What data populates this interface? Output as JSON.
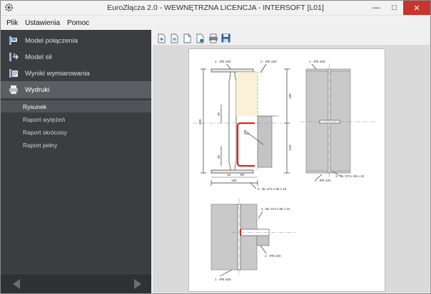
{
  "window": {
    "title": "EuroZłącza 2.0 - WEWNĘTRZNA LICENCJA - INTERSOFT [L01]",
    "app_icon": "gear-app-icon",
    "controls": [
      "minimize-icon",
      "maximize-icon",
      "close-icon"
    ]
  },
  "menu": {
    "items": [
      "Plik",
      "Ustawienia",
      "Pomoc"
    ]
  },
  "sidebar": {
    "items": [
      {
        "label": "Model połączenia",
        "icon": "connection-model-icon"
      },
      {
        "label": "Model sił",
        "icon": "forces-model-icon"
      },
      {
        "label": "Wyniki wymiarowania",
        "icon": "results-icon"
      },
      {
        "label": "Wydruki",
        "icon": "printer-icon"
      }
    ],
    "subitems": [
      "Rysunek",
      "Raport wytężeń",
      "Raport skrócony",
      "Raport pełny"
    ],
    "selected": "Wydruki",
    "active_subitem": "Rysunek"
  },
  "toolbar": {
    "buttons": [
      "new-page-icon",
      "page-icon",
      "page-outline-icon",
      "page-export-icon",
      "print-icon",
      "save-icon"
    ]
  },
  "drawing": {
    "labels": {
      "col_main": "1 - IPE 400",
      "beam_main": "2 - IPE 220",
      "col_side": "1 - IPE 400",
      "beam_side_top": "2 - IPE 220",
      "beam_side_bottom": "2 - IPE 220",
      "plate_side": "3 - BL 373 x 98 x 10",
      "plate_main": "3 - BL 373 x 98 x 10",
      "plate_plan": "3 - BL 373 x 98 x 10",
      "beam_plan": "2 - IPE 220",
      "col_plan": "1 - IPE 400"
    },
    "dims": {
      "height": "400",
      "top": "180",
      "bottom": "220",
      "d30a": "30",
      "d30b": "30",
      "d16": "16",
      "d80": "80",
      "width": "180"
    },
    "colors": {
      "highlight": "#e0201b",
      "fill_beam": "#fbf0d8",
      "fill_grey": "#c4c4c4",
      "line": "#333333"
    }
  }
}
